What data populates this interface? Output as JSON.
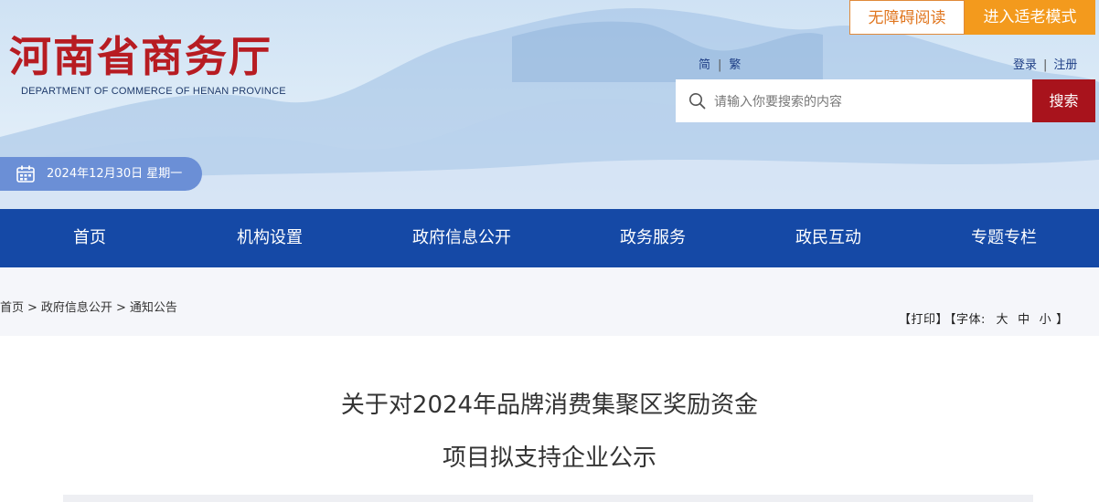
{
  "header": {
    "site_title": "河南省商务厅",
    "site_subtitle": "DEPARTMENT OF COMMERCE OF HENAN PROVINCE",
    "accessibility_label": "无障碍阅读",
    "elder_mode_label": "进入适老模式",
    "lang_simplified": "简",
    "lang_separator": "|",
    "lang_traditional": "繁",
    "login_label": "登录",
    "auth_separator": "|",
    "register_label": "注册",
    "search_placeholder": "请输入你要搜索的内容",
    "search_button": "搜索",
    "date_text": "2024年12月30日 星期一"
  },
  "nav": {
    "items": [
      {
        "label": "首页"
      },
      {
        "label": "机构设置"
      },
      {
        "label": "政府信息公开"
      },
      {
        "label": "政务服务"
      },
      {
        "label": "政民互动"
      },
      {
        "label": "专题专栏"
      }
    ]
  },
  "breadcrumb": {
    "items": [
      "首页",
      "政府信息公开",
      "通知公告"
    ],
    "separator": ">"
  },
  "tools": {
    "print_label": "【打印】",
    "font_prefix": "【字体:",
    "large": "大",
    "medium": "中",
    "small": "小",
    "font_suffix": "】"
  },
  "article": {
    "title_line1": "关于对2024年品牌消费集聚区奖励资金",
    "title_line2": "项目拟支持企业公示"
  },
  "colors": {
    "brand_red": "#b71c22",
    "nav_blue": "#1549a6",
    "search_red": "#a8131c",
    "accent_orange": "#f39a1d",
    "date_pill_blue": "#6b8fd6"
  }
}
